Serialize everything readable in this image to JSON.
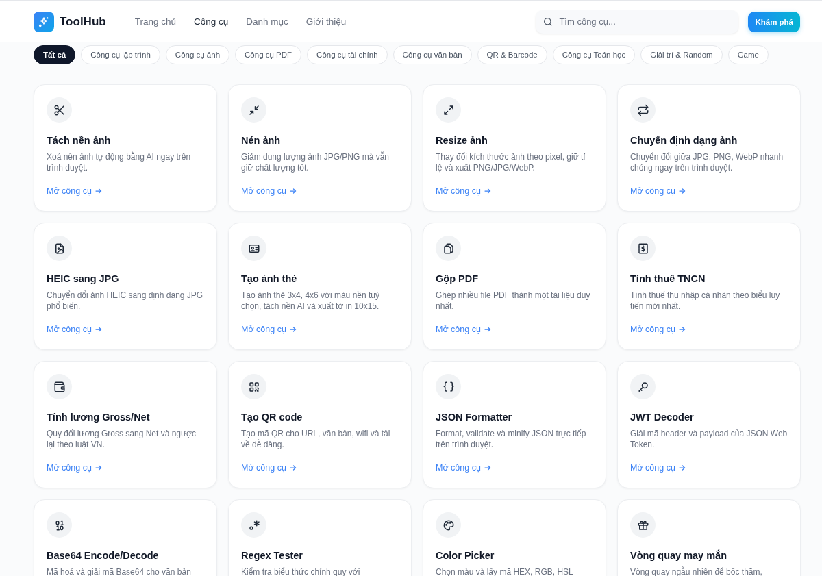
{
  "header": {
    "logo": "ToolHub",
    "nav": [
      {
        "label": "Trang chủ",
        "selected": false
      },
      {
        "label": "Công cụ",
        "selected": true
      },
      {
        "label": "Danh mục",
        "selected": false
      },
      {
        "label": "Giới thiệu",
        "selected": false
      }
    ],
    "search": {
      "placeholder": "Tìm công cụ..."
    },
    "cta": "Khám phá"
  },
  "categories": [
    {
      "label": "Tất cả",
      "selected": true
    },
    {
      "label": "Công cụ lập trình",
      "selected": false
    },
    {
      "label": "Công cụ ảnh",
      "selected": false
    },
    {
      "label": "Công cụ PDF",
      "selected": false
    },
    {
      "label": "Công cụ tài chính",
      "selected": false
    },
    {
      "label": "Công cụ văn bản",
      "selected": false
    },
    {
      "label": "QR & Barcode",
      "selected": false
    },
    {
      "label": "Công cụ Toán học",
      "selected": false
    },
    {
      "label": "Giải trí & Random",
      "selected": false
    },
    {
      "label": "Game",
      "selected": false
    }
  ],
  "tools": [
    {
      "title": "Tách nền ảnh",
      "description": "Xoá nền ảnh tự động bằng AI ngay trên trình duyệt.",
      "link": "Mở công cụ"
    },
    {
      "title": "Nén ảnh",
      "description": "Giảm dung lượng ảnh JPG/PNG mà vẫn giữ chất lượng tốt.",
      "link": "Mở công cụ"
    },
    {
      "title": "Resize ảnh",
      "description": "Thay đổi kích thước ảnh theo pixel, giữ tỉ lệ và xuất PNG/JPG/WebP.",
      "link": "Mở công cụ"
    },
    {
      "title": "Chuyển định dạng ảnh",
      "description": "Chuyển đổi giữa JPG, PNG, WebP nhanh chóng ngay trên trình duyệt.",
      "link": "Mở công cụ"
    },
    {
      "title": "HEIC sang JPG",
      "description": "Chuyển đổi ảnh HEIC sang định dạng JPG phổ biến.",
      "link": "Mở công cụ"
    },
    {
      "title": "Tạo ảnh thẻ",
      "description": "Tạo ảnh thẻ 3x4, 4x6 với màu nền tuỳ chọn, tách nền AI và xuất tờ in 10x15.",
      "link": "Mở công cụ"
    },
    {
      "title": "Gộp PDF",
      "description": "Ghép nhiều file PDF thành một tài liệu duy nhất.",
      "link": "Mở công cụ"
    },
    {
      "title": "Tính thuế TNCN",
      "description": "Tính thuế thu nhập cá nhân theo biểu lũy tiến mới nhất.",
      "link": "Mở công cụ"
    },
    {
      "title": "Tính lương Gross/Net",
      "description": "Quy đổi lương Gross sang Net và ngược lại theo luật VN.",
      "link": "Mở công cụ"
    },
    {
      "title": "Tạo QR code",
      "description": "Tạo mã QR cho URL, văn bản, wifi và tải về dễ dàng.",
      "link": "Mở công cụ"
    },
    {
      "title": "JSON Formatter",
      "description": "Format, validate và minify JSON trực tiếp trên trình duyệt.",
      "link": "Mở công cụ"
    },
    {
      "title": "JWT Decoder",
      "description": "Giải mã header và payload của JSON Web Token.",
      "link": "Mở công cụ"
    },
    {
      "title": "Base64 Encode/Decode",
      "description": "Mã hoá và giải mã Base64 cho văn bản"
    },
    {
      "title": "Regex Tester",
      "description": "Kiểm tra biểu thức chính quy với"
    },
    {
      "title": "Color Picker",
      "description": "Chọn màu và lấy mã HEX, RGB, HSL"
    },
    {
      "title": "Vòng quay may mắn",
      "description": "Vòng quay ngẫu nhiên để bốc thăm,"
    }
  ]
}
